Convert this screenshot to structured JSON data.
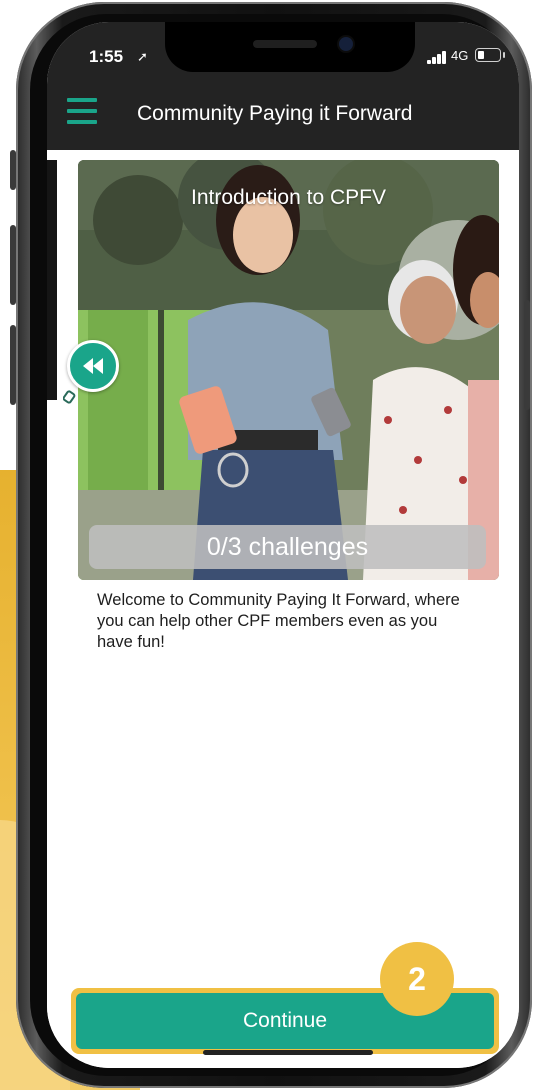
{
  "status_bar": {
    "time": "1:55",
    "location_glyph": "➚",
    "network": "4G",
    "icons": [
      "signal-icon",
      "battery-icon"
    ]
  },
  "app_bar": {
    "title": "Community Paying it Forward",
    "menu_icon": "hamburger-menu-icon"
  },
  "hero": {
    "title": "Introduction to CPFV",
    "progress_text": "0/3 challenges",
    "back_icon": "rewind-icon"
  },
  "description": "Welcome to Community Paying It Forward, where you can help other CPF members even as you have fun!",
  "continue": {
    "label": "Continue",
    "step_number": "2"
  },
  "colors": {
    "accent": "#1aa58a",
    "highlight": "#f0c044",
    "header": "#232323"
  }
}
